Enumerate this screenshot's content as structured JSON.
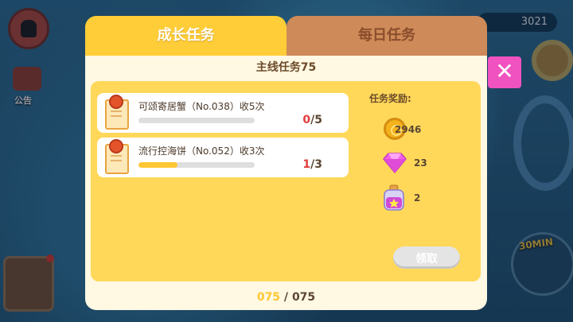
{
  "background": {
    "coin_balance": "3021",
    "notice_label": "公告",
    "timer_label": "30MIN"
  },
  "dialog": {
    "tabs": [
      {
        "label": "成长任务",
        "active": true
      },
      {
        "label": "每日任务",
        "active": false
      }
    ],
    "header": "主线任务75",
    "tasks": [
      {
        "title": "可颂寄居蟹（No.038）收5次",
        "current": "0",
        "total": "/5",
        "progress": 0.0
      },
      {
        "title": "流行控海饼（No.052）收3次",
        "current": "1",
        "total": "/3",
        "progress": 0.333
      }
    ],
    "reward": {
      "title": "任务奖励:",
      "items": [
        {
          "icon": "coin-icon",
          "value": "2946"
        },
        {
          "icon": "gem-icon",
          "value": "23"
        },
        {
          "icon": "potion-icon",
          "value": "2"
        }
      ],
      "claim_label": "领取"
    },
    "page": {
      "current": "075",
      "separator": " / ",
      "total": "075"
    },
    "close_symbol": "✕"
  },
  "colors": {
    "tab_active": "#ffcd37",
    "tab_inactive": "#ce8a58",
    "panel": "#fff8e3",
    "inner": "#ffd85a",
    "close": "#f052c0",
    "count_red": "#e23b3b"
  }
}
